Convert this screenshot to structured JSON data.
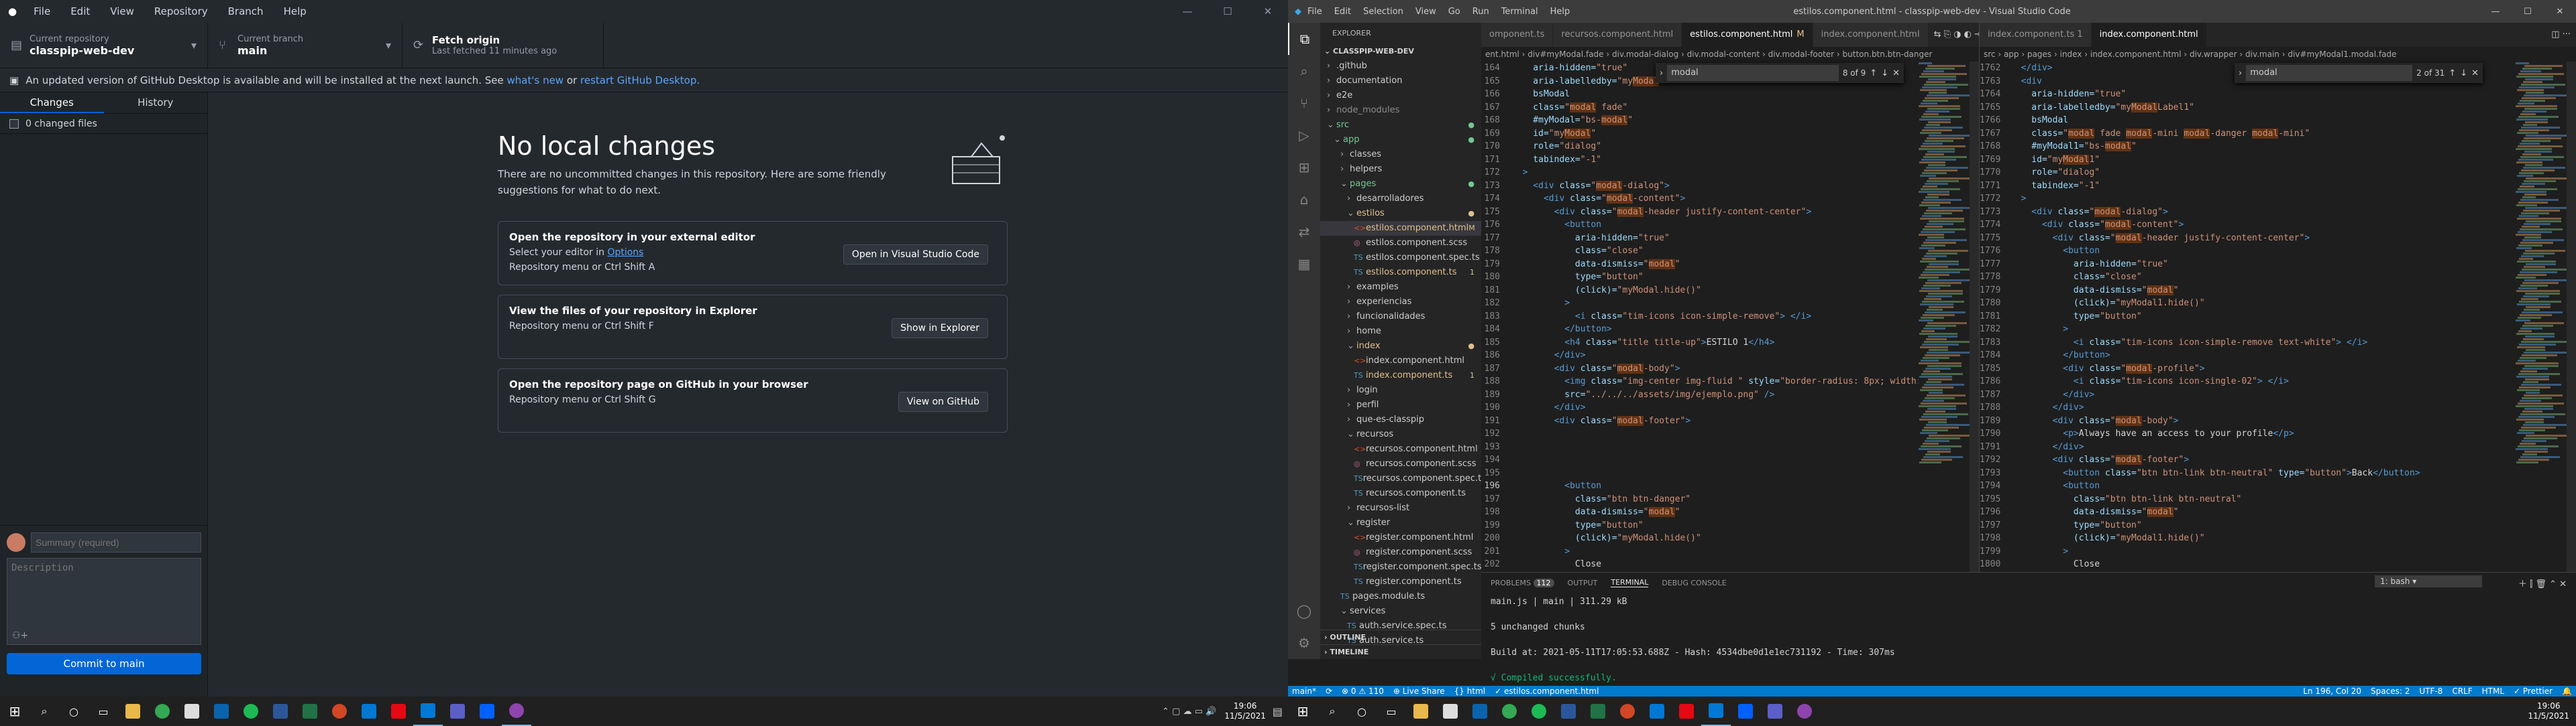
{
  "gh": {
    "menu": [
      "File",
      "Edit",
      "View",
      "Repository",
      "Branch",
      "Help"
    ],
    "toolbar": {
      "repo_label": "Current repository",
      "repo_name": "classpip-web-dev",
      "branch_label": "Current branch",
      "branch_name": "main",
      "fetch_label": "Fetch origin",
      "fetch_sub": "Last fetched 11 minutes ago"
    },
    "banner": {
      "text": "An updated version of GitHub Desktop is available and will be installed at the next launch. See",
      "link1": "what's new",
      "mid": "or",
      "link2": "restart GitHub Desktop."
    },
    "tabs": [
      "Changes",
      "History"
    ],
    "changed": "0 changed files",
    "commit": {
      "summary_placeholder": "Summary (required)",
      "description_placeholder": "Description",
      "button": "Commit to main"
    },
    "hero": {
      "title": "No local changes",
      "text": "There are no uncommitted changes in this repository. Here are some friendly suggestions for what to do next."
    },
    "cards": [
      {
        "title": "Open the repository in your external editor",
        "sub_pre": "Select your editor in",
        "sub_link": "Options",
        "shortcut": "Repository menu or  Ctrl  Shift  A",
        "button": "Open in Visual Studio Code"
      },
      {
        "title": "View the files of your repository in Explorer",
        "sub_pre": "",
        "sub_link": "",
        "shortcut": "Repository menu or  Ctrl  Shift  F",
        "button": "Show in Explorer"
      },
      {
        "title": "Open the repository page on GitHub in your browser",
        "sub_pre": "",
        "sub_link": "",
        "shortcut": "Repository menu or  Ctrl  Shift  G",
        "button": "View on GitHub"
      }
    ]
  },
  "vs": {
    "menu": [
      "File",
      "Edit",
      "Selection",
      "View",
      "Go",
      "Run",
      "Terminal",
      "Help"
    ],
    "title": "estilos.component.html - classpip-web-dev - Visual Studio Code",
    "explorer_header": "EXPLORER",
    "project": "CLASSPIP-WEB-DEV",
    "tree": [
      {
        "d": 1,
        "n": ".github",
        "t": "f",
        "c": ""
      },
      {
        "d": 1,
        "n": "documentation",
        "t": "f",
        "c": ""
      },
      {
        "d": 1,
        "n": "e2e",
        "t": "f",
        "c": ""
      },
      {
        "d": 1,
        "n": "node_modules",
        "t": "f",
        "c": "dim"
      },
      {
        "d": 1,
        "n": "src",
        "t": "fo",
        "c": "untracked",
        "b": "●"
      },
      {
        "d": 2,
        "n": "app",
        "t": "fo",
        "c": "untracked",
        "b": "●"
      },
      {
        "d": 3,
        "n": "classes",
        "t": "f",
        "c": ""
      },
      {
        "d": 3,
        "n": "helpers",
        "t": "f",
        "c": ""
      },
      {
        "d": 3,
        "n": "pages",
        "t": "fo",
        "c": "untracked",
        "b": "●"
      },
      {
        "d": 4,
        "n": "desarrolladores",
        "t": "f",
        "c": ""
      },
      {
        "d": 4,
        "n": "estilos",
        "t": "fo",
        "c": "mod",
        "b": "●"
      },
      {
        "d": 5,
        "n": "estilos.component.html",
        "t": "html",
        "c": "mod sel",
        "b": "M"
      },
      {
        "d": 5,
        "n": "estilos.component.scss",
        "t": "scss",
        "c": ""
      },
      {
        "d": 5,
        "n": "estilos.component.spec.ts",
        "t": "ts",
        "c": ""
      },
      {
        "d": 5,
        "n": "estilos.component.ts",
        "t": "ts",
        "c": "mod",
        "b": "1"
      },
      {
        "d": 4,
        "n": "examples",
        "t": "f",
        "c": ""
      },
      {
        "d": 4,
        "n": "experiencias",
        "t": "f",
        "c": ""
      },
      {
        "d": 4,
        "n": "funcionalidades",
        "t": "f",
        "c": ""
      },
      {
        "d": 4,
        "n": "home",
        "t": "f",
        "c": ""
      },
      {
        "d": 4,
        "n": "index",
        "t": "fo",
        "c": "mod",
        "b": "●"
      },
      {
        "d": 5,
        "n": "index.component.html",
        "t": "html",
        "c": ""
      },
      {
        "d": 5,
        "n": "index.component.ts",
        "t": "ts",
        "c": "mod",
        "b": "1"
      },
      {
        "d": 4,
        "n": "login",
        "t": "f",
        "c": ""
      },
      {
        "d": 4,
        "n": "perfil",
        "t": "f",
        "c": ""
      },
      {
        "d": 4,
        "n": "que-es-classpip",
        "t": "f",
        "c": ""
      },
      {
        "d": 4,
        "n": "recursos",
        "t": "fo",
        "c": ""
      },
      {
        "d": 5,
        "n": "recursos.component.html",
        "t": "html",
        "c": ""
      },
      {
        "d": 5,
        "n": "recursos.component.scss",
        "t": "scss",
        "c": ""
      },
      {
        "d": 5,
        "n": "recursos.component.spec.ts",
        "t": "ts",
        "c": ""
      },
      {
        "d": 5,
        "n": "recursos.component.ts",
        "t": "ts",
        "c": ""
      },
      {
        "d": 4,
        "n": "recursos-list",
        "t": "f",
        "c": ""
      },
      {
        "d": 4,
        "n": "register",
        "t": "fo",
        "c": ""
      },
      {
        "d": 5,
        "n": "register.component.html",
        "t": "html",
        "c": ""
      },
      {
        "d": 5,
        "n": "register.component.scss",
        "t": "scss",
        "c": ""
      },
      {
        "d": 5,
        "n": "register.component.spec.ts",
        "t": "ts",
        "c": ""
      },
      {
        "d": 5,
        "n": "register.component.ts",
        "t": "ts",
        "c": ""
      },
      {
        "d": 3,
        "n": "pages.module.ts",
        "t": "ts",
        "c": ""
      },
      {
        "d": 3,
        "n": "services",
        "t": "fo",
        "c": ""
      },
      {
        "d": 4,
        "n": "auth.service.spec.ts",
        "t": "ts",
        "c": ""
      },
      {
        "d": 4,
        "n": "auth.service.ts",
        "t": "ts",
        "c": ""
      }
    ],
    "outline": "OUTLINE",
    "timeline": "TIMELINE",
    "ed1": {
      "tabs": [
        {
          "label": "omponent.ts",
          "active": false,
          "m": ""
        },
        {
          "label": "recursos.component.html",
          "active": false,
          "m": ""
        },
        {
          "label": "estilos.component.html",
          "active": true,
          "m": "M"
        },
        {
          "label": "index.component.html",
          "active": false,
          "m": ""
        }
      ],
      "crumbs": "ent.html › div#myModal.fade › div.modal-dialog › div.modal-content › div.modal-footer › button.btn.btn-danger",
      "find": {
        "query": "modal",
        "count": "8 of 9"
      }
    },
    "ed2": {
      "tabs": [
        {
          "label": "index.component.ts 1",
          "active": false,
          "m": ""
        },
        {
          "label": "index.component.html",
          "active": true,
          "m": ""
        }
      ],
      "crumbs": "src › app › pages › index › index.component.html › div.wrapper › div.main › div#myModal1.modal.fade",
      "find": {
        "query": "modal",
        "count": "2 of 31"
      }
    },
    "panel": {
      "tabs": [
        "PROBLEMS",
        "OUTPUT",
        "TERMINAL",
        "DEBUG CONSOLE"
      ],
      "problems_count": "112",
      "shell": "1: bash",
      "lines": [
        "main.js                | main  | 311.29 kB",
        "",
        "5 unchanged chunks",
        "",
        "Build at: 2021-05-11T17:05:53.688Z - Hash: 4534dbe0d1e1ec731192 - Time: 307ms",
        "",
        "√ Compiled successfully."
      ]
    },
    "status_left": [
      "main*",
      "⟳",
      "⊗ 0 ⚠ 110",
      "⊕ Live Share",
      "{} html",
      "✓ estilos.component.html"
    ],
    "status_right": [
      "Ln 196, Col 20",
      "Spaces: 2",
      "UTF-8",
      "CRLF",
      "HTML",
      "✓ Prettier"
    ]
  },
  "clock1": {
    "time": "19:06",
    "date": "11/5/2021"
  },
  "clock2": {
    "time": "19:06",
    "date": "11/5/2021"
  }
}
